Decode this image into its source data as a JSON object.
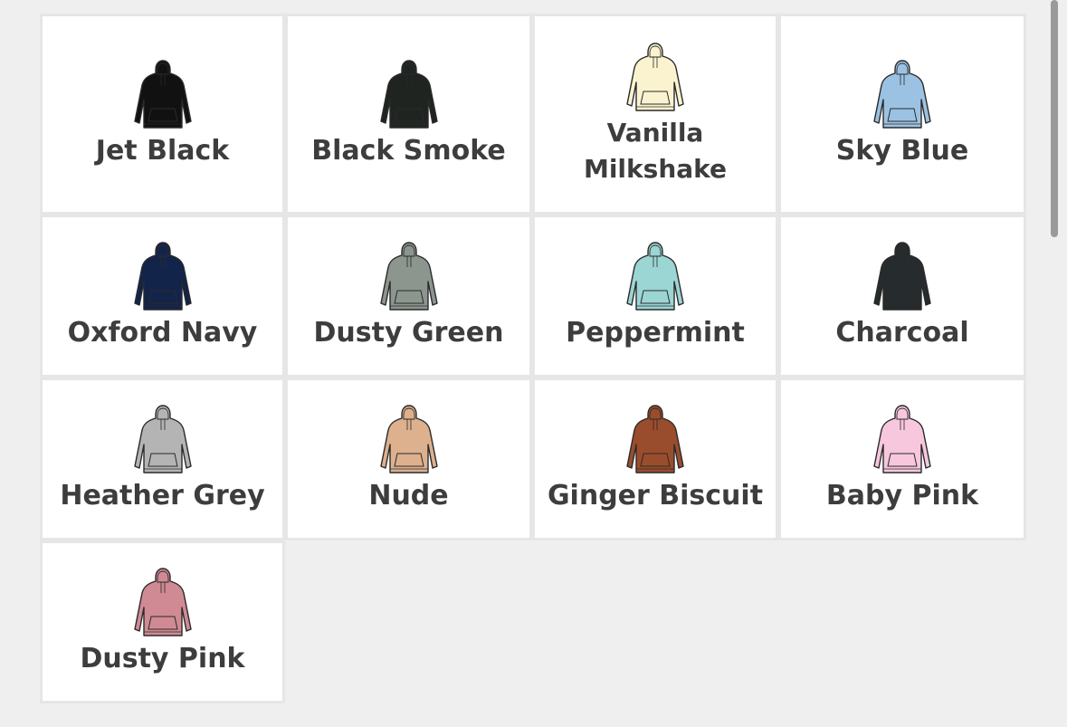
{
  "colours": [
    {
      "label": "Jet Black",
      "hex": "#111111"
    },
    {
      "label": "Black Smoke",
      "hex": "#1f2421"
    },
    {
      "label": "Vanilla Milkshake",
      "hex": "#fbf3cf"
    },
    {
      "label": "Sky Blue",
      "hex": "#9cc2e3"
    },
    {
      "label": "Oxford Navy",
      "hex": "#13244b"
    },
    {
      "label": "Dusty Green",
      "hex": "#8c968e"
    },
    {
      "label": "Peppermint",
      "hex": "#9bd5d4"
    },
    {
      "label": "Charcoal",
      "hex": "#262b2d"
    },
    {
      "label": "Heather Grey",
      "hex": "#b4b4b4"
    },
    {
      "label": "Nude",
      "hex": "#ddb08e"
    },
    {
      "label": "Ginger Biscuit",
      "hex": "#9a4d2c"
    },
    {
      "label": "Baby Pink",
      "hex": "#f7c7dd"
    },
    {
      "label": "Dusty Pink",
      "hex": "#d08a93"
    }
  ],
  "icon": "hoodie-icon"
}
